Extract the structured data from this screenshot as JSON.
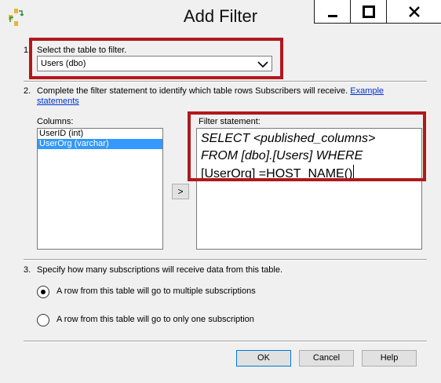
{
  "window": {
    "title": "Add Filter",
    "app_icon": "replication-icon",
    "controls": [
      "minimize-icon",
      "maximize-icon",
      "close-icon"
    ]
  },
  "step1": {
    "number": "1.",
    "label": "Select the table to filter.",
    "selected_table": "Users (dbo)"
  },
  "step2": {
    "number": "2.",
    "label": "Complete the filter statement to identify which table rows Subscribers will receive.",
    "link": "Example statements",
    "columns_label": "Columns:",
    "columns": [
      "UserID (int)",
      "UserOrg (varchar)"
    ],
    "selected_column": "UserOrg (varchar)",
    "add_button": ">",
    "filter_label": "Filter statement:",
    "filter_line1": "SELECT <published_columns>",
    "filter_line2": "FROM [dbo].[Users] WHERE",
    "filter_line3": "[UserOrg] =HOST_NAME()"
  },
  "step3": {
    "number": "3.",
    "label": "Specify how many subscriptions will receive data from this table.",
    "option_multiple": "A row from this table will go to multiple subscriptions",
    "option_single": "A row from this table will go to only one subscription",
    "selected": "multiple"
  },
  "buttons": {
    "ok": "OK",
    "cancel": "Cancel",
    "help": "Help"
  },
  "colors": {
    "highlight": "#b0181d",
    "selection": "#3399ff",
    "link": "#0033cc"
  }
}
